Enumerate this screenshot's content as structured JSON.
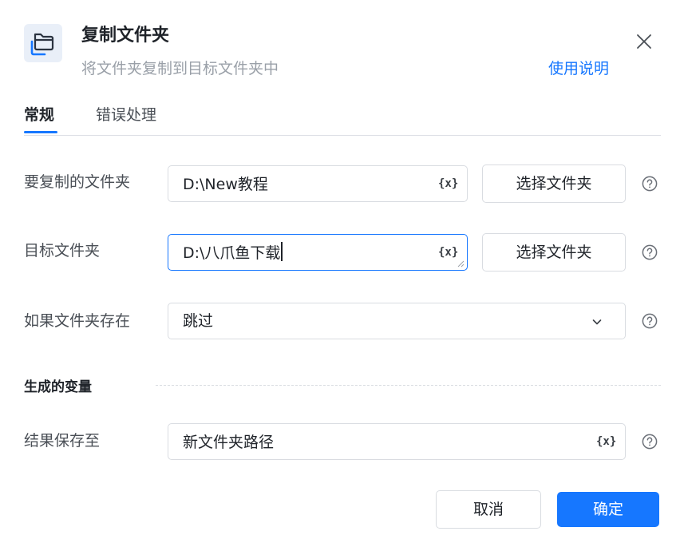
{
  "header": {
    "icon": "folder-copy-icon",
    "title": "复制文件夹",
    "subtitle": "将文件夹复制到目标文件夹中",
    "help_link": "使用说明"
  },
  "tabs": [
    {
      "label": "常规",
      "active": true
    },
    {
      "label": "错误处理",
      "active": false
    }
  ],
  "form": {
    "source": {
      "label": "要复制的文件夹",
      "value": "D:\\New教程",
      "var_icon": "{x}",
      "button": "选择文件夹"
    },
    "target": {
      "label": "目标文件夹",
      "value": "D:\\八爪鱼下载",
      "var_icon": "{x}",
      "button": "选择文件夹"
    },
    "if_exists": {
      "label": "如果文件夹存在",
      "value": "跳过"
    }
  },
  "output": {
    "section_title": "生成的变量",
    "result": {
      "label": "结果保存至",
      "value": "新文件夹路径",
      "var_icon": "{x}"
    }
  },
  "footer": {
    "cancel": "取消",
    "ok": "确定"
  },
  "colors": {
    "accent": "#1677ff",
    "border": "#d9dce1",
    "muted_text": "#9aa0a8"
  }
}
